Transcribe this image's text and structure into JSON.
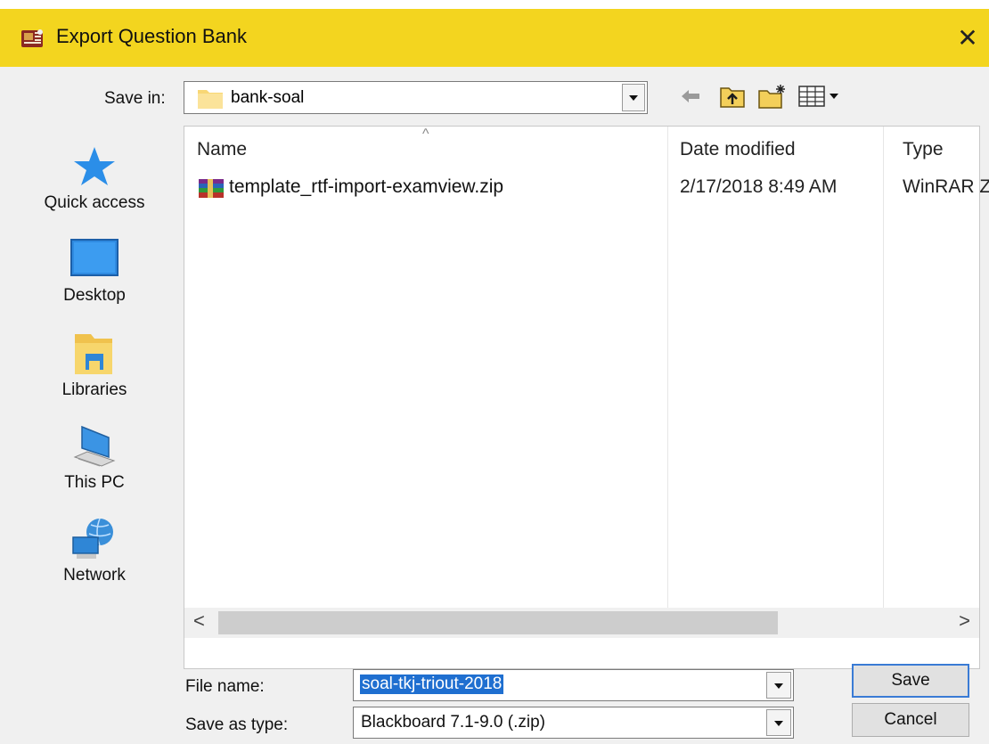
{
  "window": {
    "title": "Export Question Bank",
    "close_glyph": "✕",
    "titlebar_color": "#f3d51f",
    "app_icon": "app-icon"
  },
  "toolbar": {
    "save_in_label": "Save in:",
    "save_in_value": "bank-soal",
    "icons": [
      "back-arrow-icon",
      "up-folder-icon",
      "new-folder-icon",
      "views-menu-icon"
    ]
  },
  "places": [
    {
      "label": "Quick access",
      "icon": "star-icon"
    },
    {
      "label": "Desktop",
      "icon": "desktop-icon"
    },
    {
      "label": "Libraries",
      "icon": "libraries-icon"
    },
    {
      "label": "This PC",
      "icon": "computer-icon"
    },
    {
      "label": "Network",
      "icon": "globe-icon"
    }
  ],
  "file_list": {
    "columns": [
      "Name",
      "Date modified",
      "Type"
    ],
    "sort_indicator": "^",
    "rows": [
      {
        "name": "template_rtf-import-examview.zip",
        "date": "2/17/2018 8:49 AM",
        "type": "WinRAR Z",
        "icon": "winrar-archive-icon"
      }
    ],
    "scroll_left": "<",
    "scroll_right": ">"
  },
  "form": {
    "file_name_label": "File name:",
    "file_name_value": "soal-tkj-triout-2018",
    "save_as_type_label": "Save as type:",
    "save_as_type_value": "Blackboard 7.1-9.0 (.zip)",
    "save_button": "Save",
    "cancel_button": "Cancel"
  },
  "colors": {
    "selection": "#1f6fd0",
    "accent_border": "#3a7bd5"
  }
}
